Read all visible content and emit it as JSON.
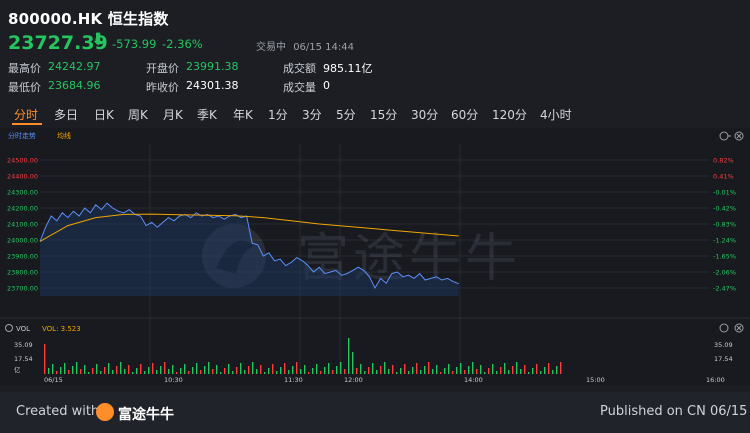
{
  "header": {
    "title": "800000.HK 恒生指数",
    "price": "23727.39",
    "change": "-573.99",
    "change_pct": "-2.36%",
    "status": "交易中",
    "datetime": "06/15 14:44"
  },
  "stats": {
    "high_label": "最高价",
    "high": "24242.97",
    "low_label": "最低价",
    "low": "23684.96",
    "open_label": "开盘价",
    "open": "23991.38",
    "prev_label": "昨收价",
    "prev": "24301.38",
    "turnover_label": "成交额",
    "turnover": "985.11亿",
    "volume_label": "成交量",
    "volume": "0"
  },
  "tabs": [
    "分时",
    "多日",
    "日K",
    "周K",
    "月K",
    "季K",
    "年K",
    "1分",
    "3分",
    "5分",
    "15分",
    "30分",
    "60分",
    "120分",
    "4小时"
  ],
  "active_tab": "分时",
  "legend": {
    "price": "分时走势",
    "avg": "均线"
  },
  "volume_legend": {
    "label": "VOL",
    "value": "VOL: 3.523"
  },
  "colors": {
    "up": "#ff3b3b",
    "down": "#25c55f",
    "price_line": "#5b8ff9",
    "avg_line": "#f0a500",
    "accent": "#ff8d2a"
  },
  "chart_data": {
    "type": "line",
    "y_ticks": [
      "24500.00",
      "24400.00",
      "24300.00",
      "24200.00",
      "24100.00",
      "24000.00",
      "23900.00",
      "23800.00",
      "23700.00"
    ],
    "pct_ticks": [
      "0.82%",
      "0.41%",
      "-0.01%",
      "-0.42%",
      "-0.83%",
      "-1.24%",
      "-1.65%",
      "-2.06%",
      "-2.47%"
    ],
    "ylim": [
      23650,
      24550
    ],
    "x_labels": [
      "06/15",
      "10:30",
      "11:30",
      "12:00",
      "14:00",
      "15:00",
      "16:00"
    ],
    "vol_ticks": [
      "35.09",
      "17.54",
      "亿"
    ],
    "series": [
      {
        "name": "分时走势",
        "x": [
          0,
          4,
          8,
          12,
          16,
          20,
          24,
          28,
          32,
          36,
          40,
          44,
          48,
          52,
          56,
          60,
          64,
          68,
          72,
          76,
          80,
          84,
          88,
          92,
          96,
          100,
          104,
          108,
          112,
          116,
          120,
          124,
          128,
          132,
          136,
          140,
          144,
          148,
          152,
          156,
          160,
          164,
          168,
          172,
          176,
          180,
          184,
          188,
          192,
          196,
          200,
          204,
          208,
          212,
          216,
          220,
          224,
          228,
          232,
          236,
          240,
          244,
          248,
          252,
          256,
          260,
          264,
          268,
          272,
          276,
          280,
          284,
          288,
          292,
          296,
          300
        ],
        "values": [
          23991,
          24080,
          24150,
          24120,
          24170,
          24140,
          24180,
          24150,
          24200,
          24170,
          24220,
          24190,
          24230,
          24200,
          24180,
          24170,
          24190,
          24160,
          24150,
          24090,
          24110,
          24080,
          24110,
          24140,
          24120,
          24150,
          24160,
          24140,
          24170,
          24150,
          24160,
          24140,
          24150,
          24130,
          24150,
          24160,
          24140,
          24150,
          23980,
          23970,
          23900,
          23920,
          23870,
          23880,
          23840,
          23860,
          23890,
          23870,
          23840,
          23800,
          23830,
          23790,
          23800,
          23810,
          23780,
          23790,
          23810,
          23830,
          23810,
          23770,
          23700,
          23760,
          23730,
          23790,
          23800,
          23770,
          23780,
          23760,
          23790,
          23750,
          23760,
          23770,
          23750,
          23760,
          23740,
          23727
        ]
      },
      {
        "name": "均线",
        "x": [
          0,
          20,
          40,
          60,
          80,
          100,
          120,
          140,
          160,
          180,
          200,
          220,
          240,
          260,
          280,
          300
        ],
        "values": [
          23991,
          24090,
          24140,
          24160,
          24162,
          24158,
          24155,
          24152,
          24140,
          24120,
          24100,
          24085,
          24070,
          24055,
          24040,
          24025
        ]
      }
    ]
  },
  "footer": {
    "created_with": "Created with",
    "brand": "富途牛牛",
    "published": "Published on CN 06/15"
  }
}
